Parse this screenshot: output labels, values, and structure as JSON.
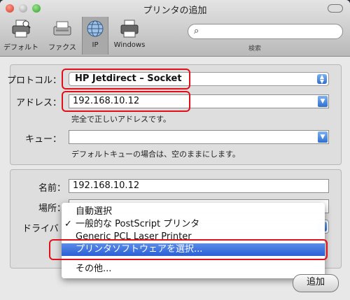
{
  "window": {
    "title": "プリンタの追加"
  },
  "toolbar": {
    "items": [
      {
        "label": "デフォルト",
        "icon": "printer-default-icon"
      },
      {
        "label": "ファクス",
        "icon": "fax-icon"
      },
      {
        "label": "IP",
        "icon": "globe-icon"
      },
      {
        "label": "Windows",
        "icon": "windows-printer-icon"
      }
    ],
    "search_label": "検索",
    "search_placeholder": ""
  },
  "form": {
    "protocol_label": "プロトコル：",
    "protocol_value": "HP Jetdirect – Socket",
    "address_label": "アドレス：",
    "address_value": "192.168.10.12",
    "address_hint": "完全で正しいアドレスです。",
    "queue_label": "キュー：",
    "queue_value": "",
    "queue_hint": "デフォルトキューの場合は、空のままにします。"
  },
  "details": {
    "name_label": "名前：",
    "name_value": "192.168.10.12",
    "location_label": "場所：",
    "location_value": "",
    "driver_label": "ドライバ"
  },
  "driver_menu": {
    "items": [
      {
        "label": "自動選択",
        "checked": false,
        "highlighted": false
      },
      {
        "label": "一般的な PostScript プリンタ",
        "checked": true,
        "highlighted": false
      },
      {
        "label": "Generic PCL Laser Printer",
        "checked": false,
        "highlighted": false
      },
      {
        "label": "プリンタソフトウェアを選択...",
        "checked": false,
        "highlighted": true
      },
      {
        "label": "その他...",
        "checked": false,
        "highlighted": false
      }
    ],
    "check_glyph": "✓"
  },
  "buttons": {
    "add_label": "追加"
  },
  "colors": {
    "annotation": "#e0101a",
    "highlight": "#2a5fd6"
  }
}
